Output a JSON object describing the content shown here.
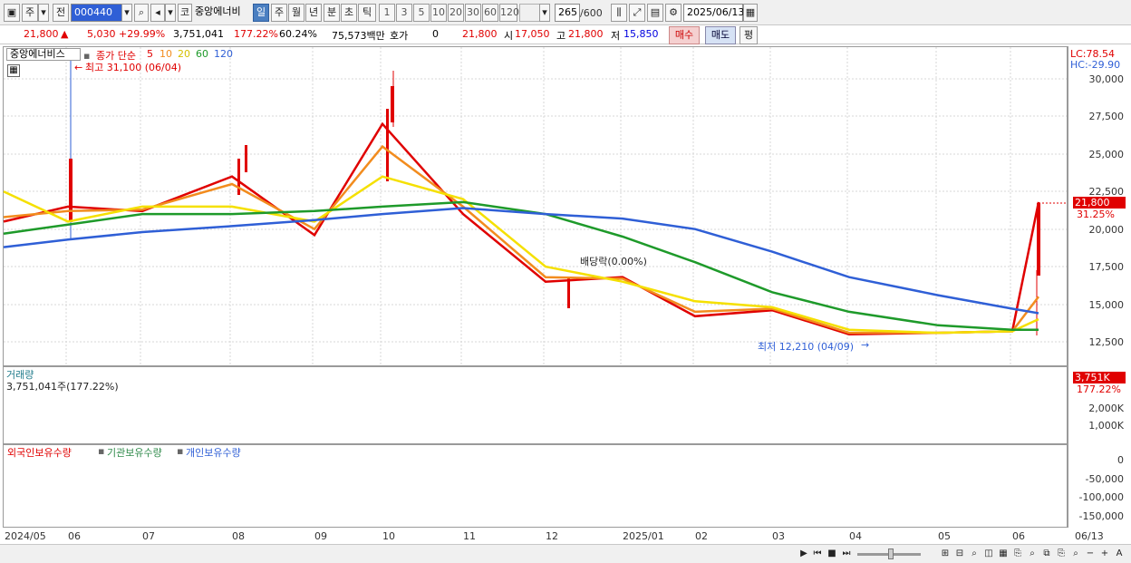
{
  "toolbar": {
    "market": "주",
    "range_btn": "전",
    "code": "000440",
    "name_prefix": "코",
    "stock_name": "중앙에너비",
    "periods": [
      "일",
      "주",
      "월",
      "년",
      "분",
      "초",
      "틱"
    ],
    "active_period": "일",
    "numbers": [
      "1",
      "3",
      "5",
      "10",
      "20",
      "30",
      "60",
      "120"
    ],
    "count": "265",
    "count_max": "/600",
    "date": "2025/06/13"
  },
  "quote": {
    "price": "21,800",
    "change": "5,030",
    "change_pct": "+29.99%",
    "volume": "3,751,041",
    "vol_ratio": "177.22%",
    "ratio2": "60.24%",
    "amount": "75,573백만",
    "hoga_label": "호가",
    "hoga_value": "0",
    "hoga_price": "21,800",
    "open_label": "시",
    "open": "17,050",
    "high_label": "고",
    "high": "21,800",
    "low_label": "저",
    "low": "15,850",
    "buy": "매수",
    "sell": "매도",
    "avg": "평"
  },
  "price_panel": {
    "stock_label": "중앙에너비스",
    "ma_label": "종가 단순",
    "ma_periods": [
      "5",
      "10",
      "20",
      "60",
      "120"
    ],
    "ma_colors": [
      "#e00000",
      "#f28c1e",
      "#f5e000",
      "#1e9a2a",
      "#2f5fd6"
    ],
    "high_note": "최고 31,100 (06/04)",
    "low_note": "최저 12,210 (04/09)",
    "dividend_note": "배당락(0.00%)",
    "lc": "LC:78.54",
    "hc": "HC:-29.90",
    "yticks": [
      "30,000",
      "27,500",
      "25,000",
      "22,500",
      "20,000",
      "17,500",
      "15,000",
      "12,500"
    ],
    "current_badge": "21,800",
    "current_pct": "31.25%"
  },
  "volume_panel": {
    "title": "거래량",
    "value": "3,751,041주(177.22%)",
    "yticks": [
      "2,000K",
      "1,000K"
    ],
    "badge": "3,751K",
    "badge_pct": "177.22%"
  },
  "holdings_panel": {
    "legend": [
      "외국인보유수량",
      "기관보유수량",
      "개인보유수량"
    ],
    "colors": [
      "#e00000",
      "#2f8a4a",
      "#2f5fd6"
    ],
    "yticks": [
      "0",
      "-50,000",
      "-100,000",
      "-150,000"
    ]
  },
  "xaxis": {
    "labels": [
      "2024/05",
      "06",
      "07",
      "08",
      "09",
      "10",
      "11",
      "12",
      "2025/01",
      "02",
      "03",
      "04",
      "05",
      "06"
    ],
    "right_label": "06/13"
  },
  "chart_data": {
    "type": "line",
    "title": "중앙에너비스",
    "x": [
      "2024/05",
      "06",
      "07",
      "08",
      "09",
      "10",
      "11",
      "12",
      "2025/01",
      "02",
      "03",
      "04",
      "05",
      "06",
      "06/13"
    ],
    "ylim": [
      11500,
      31500
    ],
    "series": [
      {
        "name": "5",
        "values": [
          20500,
          21500,
          21200,
          23500,
          19600,
          27000,
          21000,
          16500,
          16800,
          14200,
          14600,
          13000,
          13100,
          13200,
          21800
        ]
      },
      {
        "name": "10",
        "values": [
          20800,
          21200,
          21300,
          23000,
          20000,
          25500,
          21500,
          16800,
          16700,
          14500,
          14700,
          13100,
          13100,
          13200,
          15500
        ]
      },
      {
        "name": "20",
        "values": [
          22500,
          20500,
          21500,
          21500,
          20500,
          23500,
          22000,
          17500,
          16500,
          15200,
          14800,
          13300,
          13100,
          13200,
          14000
        ]
      },
      {
        "name": "60",
        "values": [
          19700,
          20300,
          21000,
          21000,
          21200,
          21500,
          21800,
          21000,
          19500,
          17800,
          15800,
          14500,
          13600,
          13300,
          13300
        ]
      },
      {
        "name": "120",
        "values": [
          18800,
          19300,
          19800,
          20200,
          20600,
          21000,
          21400,
          21000,
          20700,
          20000,
          18500,
          16800,
          15600,
          14700,
          14400
        ]
      }
    ]
  }
}
